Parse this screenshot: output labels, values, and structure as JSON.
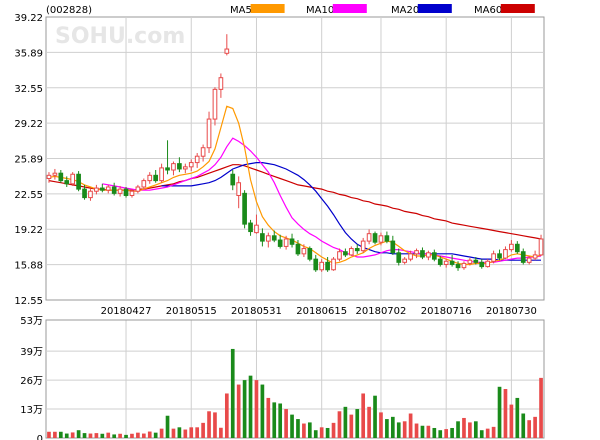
{
  "header": {
    "stock_code": "(002828)",
    "watermark": "SOHU.com"
  },
  "legend": [
    {
      "label": "MA5",
      "color": "#ff9900"
    },
    {
      "label": "MA10",
      "color": "#ff00ff"
    },
    {
      "label": "MA20",
      "color": "#0000cc"
    },
    {
      "label": "MA60",
      "color": "#cc0000"
    }
  ],
  "colors": {
    "up": "#e84a4a",
    "down": "#1a8a1a",
    "grid": "#cfcfcf",
    "frame": "#999999",
    "ma5": "#ff9900",
    "ma10": "#ff00ff",
    "ma20": "#0000cc",
    "ma60": "#cc0000"
  },
  "chart_data": [
    {
      "type": "candlestick",
      "y_ticks": [
        "39.22",
        "35.89",
        "32.55",
        "29.22",
        "25.89",
        "22.55",
        "19.22",
        "15.88",
        "12.55"
      ],
      "ylim": [
        12.55,
        39.22
      ],
      "x_tick_labels": [
        {
          "label": "20180427",
          "index": 13
        },
        {
          "label": "20180515",
          "index": 24
        },
        {
          "label": "20180531",
          "index": 35
        },
        {
          "label": "20180615",
          "index": 46
        },
        {
          "label": "20180702",
          "index": 56
        },
        {
          "label": "20180716",
          "index": 67
        },
        {
          "label": "20180730",
          "index": 78
        }
      ],
      "candles": [
        {
          "o": 24.0,
          "h": 24.6,
          "l": 23.6,
          "c": 24.3
        },
        {
          "o": 24.3,
          "h": 24.9,
          "l": 23.9,
          "c": 24.5
        },
        {
          "o": 24.5,
          "h": 24.8,
          "l": 23.6,
          "c": 23.8
        },
        {
          "o": 23.8,
          "h": 24.2,
          "l": 23.2,
          "c": 23.5
        },
        {
          "o": 23.5,
          "h": 24.6,
          "l": 23.3,
          "c": 24.4
        },
        {
          "o": 24.4,
          "h": 24.7,
          "l": 22.8,
          "c": 23.0
        },
        {
          "o": 23.0,
          "h": 23.4,
          "l": 22.0,
          "c": 22.2
        },
        {
          "o": 22.2,
          "h": 23.0,
          "l": 21.9,
          "c": 22.8
        },
        {
          "o": 22.8,
          "h": 23.4,
          "l": 22.5,
          "c": 23.1
        },
        {
          "o": 23.1,
          "h": 23.5,
          "l": 22.7,
          "c": 22.9
        },
        {
          "o": 22.9,
          "h": 23.4,
          "l": 22.6,
          "c": 23.2
        },
        {
          "o": 23.2,
          "h": 23.6,
          "l": 22.4,
          "c": 22.6
        },
        {
          "o": 22.6,
          "h": 23.3,
          "l": 22.3,
          "c": 23.0
        },
        {
          "o": 23.0,
          "h": 23.2,
          "l": 22.2,
          "c": 22.4
        },
        {
          "o": 22.4,
          "h": 23.0,
          "l": 22.2,
          "c": 22.8
        },
        {
          "o": 22.8,
          "h": 23.4,
          "l": 22.6,
          "c": 23.2
        },
        {
          "o": 23.2,
          "h": 24.0,
          "l": 23.0,
          "c": 23.8
        },
        {
          "o": 23.8,
          "h": 24.6,
          "l": 23.5,
          "c": 24.3
        },
        {
          "o": 24.3,
          "h": 24.8,
          "l": 23.6,
          "c": 23.8
        },
        {
          "o": 23.8,
          "h": 25.4,
          "l": 23.6,
          "c": 25.0
        },
        {
          "o": 25.0,
          "h": 27.6,
          "l": 24.4,
          "c": 24.8
        },
        {
          "o": 24.8,
          "h": 25.6,
          "l": 24.3,
          "c": 25.4
        },
        {
          "o": 25.4,
          "h": 26.0,
          "l": 24.6,
          "c": 24.9
        },
        {
          "o": 24.9,
          "h": 25.4,
          "l": 24.5,
          "c": 25.1
        },
        {
          "o": 25.1,
          "h": 25.8,
          "l": 24.7,
          "c": 25.5
        },
        {
          "o": 25.5,
          "h": 26.4,
          "l": 25.0,
          "c": 26.1
        },
        {
          "o": 26.1,
          "h": 27.2,
          "l": 25.6,
          "c": 26.9
        },
        {
          "o": 26.9,
          "h": 30.3,
          "l": 26.4,
          "c": 29.6
        },
        {
          "o": 29.6,
          "h": 32.6,
          "l": 29.0,
          "c": 32.4
        },
        {
          "o": 32.4,
          "h": 33.9,
          "l": 31.6,
          "c": 33.5
        },
        {
          "o": 35.8,
          "h": 37.6,
          "l": 35.6,
          "c": 36.2
        },
        {
          "o": 24.4,
          "h": 24.8,
          "l": 22.9,
          "c": 23.4
        },
        {
          "o": 22.4,
          "h": 24.2,
          "l": 21.2,
          "c": 23.6
        },
        {
          "o": 22.6,
          "h": 22.9,
          "l": 19.3,
          "c": 19.7
        },
        {
          "o": 19.8,
          "h": 20.1,
          "l": 18.6,
          "c": 19.0
        },
        {
          "o": 18.9,
          "h": 20.6,
          "l": 18.8,
          "c": 19.6
        },
        {
          "o": 18.8,
          "h": 19.3,
          "l": 17.6,
          "c": 18.1
        },
        {
          "o": 18.1,
          "h": 18.9,
          "l": 17.5,
          "c": 18.6
        },
        {
          "o": 18.6,
          "h": 19.1,
          "l": 18.0,
          "c": 18.2
        },
        {
          "o": 18.2,
          "h": 18.7,
          "l": 17.4,
          "c": 17.6
        },
        {
          "o": 17.6,
          "h": 18.6,
          "l": 17.3,
          "c": 18.3
        },
        {
          "o": 18.3,
          "h": 18.8,
          "l": 17.5,
          "c": 17.8
        },
        {
          "o": 17.8,
          "h": 18.2,
          "l": 16.7,
          "c": 16.9
        },
        {
          "o": 16.9,
          "h": 17.8,
          "l": 16.6,
          "c": 17.4
        },
        {
          "o": 17.4,
          "h": 17.6,
          "l": 16.2,
          "c": 16.4
        },
        {
          "o": 16.4,
          "h": 16.8,
          "l": 15.2,
          "c": 15.4
        },
        {
          "o": 15.4,
          "h": 16.4,
          "l": 15.2,
          "c": 16.1
        },
        {
          "o": 16.1,
          "h": 16.6,
          "l": 15.2,
          "c": 15.4
        },
        {
          "o": 15.4,
          "h": 16.6,
          "l": 15.3,
          "c": 16.4
        },
        {
          "o": 16.4,
          "h": 17.4,
          "l": 16.2,
          "c": 17.1
        },
        {
          "o": 17.1,
          "h": 17.4,
          "l": 16.6,
          "c": 16.8
        },
        {
          "o": 16.8,
          "h": 17.6,
          "l": 16.7,
          "c": 17.4
        },
        {
          "o": 17.4,
          "h": 17.8,
          "l": 16.9,
          "c": 17.2
        },
        {
          "o": 17.2,
          "h": 18.4,
          "l": 17.0,
          "c": 18.1
        },
        {
          "o": 18.1,
          "h": 19.2,
          "l": 17.8,
          "c": 18.8
        },
        {
          "o": 18.8,
          "h": 19.0,
          "l": 17.8,
          "c": 18.0
        },
        {
          "o": 18.0,
          "h": 18.9,
          "l": 17.7,
          "c": 18.6
        },
        {
          "o": 18.6,
          "h": 19.0,
          "l": 17.9,
          "c": 18.1
        },
        {
          "o": 18.1,
          "h": 18.6,
          "l": 16.8,
          "c": 17.0
        },
        {
          "o": 17.0,
          "h": 17.4,
          "l": 15.8,
          "c": 16.1
        },
        {
          "o": 16.1,
          "h": 16.6,
          "l": 15.9,
          "c": 16.4
        },
        {
          "o": 16.4,
          "h": 17.2,
          "l": 16.2,
          "c": 16.9
        },
        {
          "o": 16.9,
          "h": 17.4,
          "l": 16.5,
          "c": 17.2
        },
        {
          "o": 17.2,
          "h": 17.5,
          "l": 16.4,
          "c": 16.6
        },
        {
          "o": 16.6,
          "h": 17.2,
          "l": 16.3,
          "c": 17.0
        },
        {
          "o": 17.0,
          "h": 17.3,
          "l": 16.2,
          "c": 16.4
        },
        {
          "o": 16.4,
          "h": 16.7,
          "l": 15.7,
          "c": 15.9
        },
        {
          "o": 15.9,
          "h": 16.4,
          "l": 15.6,
          "c": 16.2
        },
        {
          "o": 16.2,
          "h": 16.8,
          "l": 15.7,
          "c": 15.9
        },
        {
          "o": 15.9,
          "h": 16.2,
          "l": 15.3,
          "c": 15.6
        },
        {
          "o": 15.6,
          "h": 16.2,
          "l": 15.4,
          "c": 16.0
        },
        {
          "o": 16.0,
          "h": 16.5,
          "l": 15.8,
          "c": 16.3
        },
        {
          "o": 16.3,
          "h": 16.6,
          "l": 15.9,
          "c": 16.1
        },
        {
          "o": 16.1,
          "h": 16.4,
          "l": 15.5,
          "c": 15.7
        },
        {
          "o": 15.7,
          "h": 16.4,
          "l": 15.6,
          "c": 16.2
        },
        {
          "o": 16.2,
          "h": 17.2,
          "l": 16.0,
          "c": 16.9
        },
        {
          "o": 16.9,
          "h": 17.3,
          "l": 16.3,
          "c": 16.5
        },
        {
          "o": 16.5,
          "h": 17.6,
          "l": 16.4,
          "c": 17.3
        },
        {
          "o": 17.3,
          "h": 18.2,
          "l": 17.1,
          "c": 17.8
        },
        {
          "o": 17.8,
          "h": 18.1,
          "l": 16.9,
          "c": 17.1
        },
        {
          "o": 17.1,
          "h": 17.4,
          "l": 15.9,
          "c": 16.1
        },
        {
          "o": 16.1,
          "h": 16.7,
          "l": 15.9,
          "c": 16.5
        },
        {
          "o": 16.5,
          "h": 17.2,
          "l": 16.3,
          "c": 16.8
        },
        {
          "o": 16.8,
          "h": 18.7,
          "l": 16.7,
          "c": 18.3
        }
      ],
      "ma5": [
        24.1,
        24.2,
        24.1,
        24.0,
        23.9,
        23.7,
        23.4,
        23.2,
        23.0,
        22.9,
        22.9,
        22.9,
        22.9,
        22.9,
        22.8,
        22.8,
        23.0,
        23.2,
        23.4,
        23.6,
        23.8,
        24.1,
        24.3,
        24.4,
        24.5,
        24.7,
        25.1,
        25.6,
        26.8,
        28.8,
        30.8,
        30.6,
        29.2,
        26.9,
        23.9,
        21.8,
        20.4,
        19.6,
        19.0,
        18.6,
        18.4,
        18.2,
        17.9,
        17.6,
        17.4,
        17.0,
        16.6,
        16.3,
        16.0,
        16.1,
        16.3,
        16.6,
        16.8,
        17.0,
        17.4,
        17.7,
        17.9,
        18.1,
        18.0,
        17.6,
        17.2,
        16.9,
        16.7,
        16.7,
        16.8,
        16.8,
        16.6,
        16.4,
        16.2,
        16.0,
        15.9,
        15.9,
        16.0,
        16.0,
        16.0,
        16.2,
        16.3,
        16.5,
        16.8,
        16.9,
        16.8,
        16.7,
        16.6,
        16.8
      ],
      "ma10": [
        null,
        null,
        null,
        null,
        null,
        null,
        null,
        null,
        null,
        23.5,
        23.4,
        23.3,
        23.2,
        23.1,
        23.0,
        22.9,
        22.9,
        22.9,
        23.0,
        23.1,
        23.2,
        23.4,
        23.6,
        23.8,
        24.0,
        24.2,
        24.5,
        24.8,
        25.3,
        26.0,
        27.0,
        27.8,
        27.5,
        27.1,
        26.6,
        26.0,
        25.3,
        24.6,
        23.6,
        22.4,
        21.3,
        20.3,
        19.7,
        19.2,
        18.8,
        18.5,
        18.1,
        17.8,
        17.5,
        17.3,
        17.0,
        16.8,
        16.6,
        16.6,
        16.7,
        16.8,
        17.0,
        17.2,
        17.3,
        17.3,
        17.2,
        17.1,
        17.0,
        16.9,
        16.9,
        16.8,
        16.7,
        16.6,
        16.5,
        16.4,
        16.3,
        16.2,
        16.1,
        16.1,
        16.1,
        16.1,
        16.2,
        16.3,
        16.4,
        16.5,
        16.5,
        16.6,
        16.6,
        16.7
      ],
      "ma20": [
        null,
        null,
        null,
        null,
        null,
        null,
        null,
        null,
        null,
        null,
        null,
        null,
        null,
        null,
        null,
        null,
        null,
        null,
        null,
        23.3,
        23.3,
        23.3,
        23.3,
        23.3,
        23.3,
        23.4,
        23.5,
        23.6,
        23.8,
        24.1,
        24.5,
        24.9,
        25.1,
        25.3,
        25.4,
        25.5,
        25.5,
        25.4,
        25.3,
        25.1,
        24.9,
        24.6,
        24.3,
        23.9,
        23.4,
        22.8,
        22.1,
        21.4,
        20.6,
        19.7,
        18.9,
        18.3,
        17.8,
        17.5,
        17.3,
        17.1,
        17.0,
        17.0,
        16.9,
        16.9,
        16.9,
        16.9,
        16.9,
        16.9,
        16.9,
        16.9,
        16.9,
        16.9,
        16.9,
        16.8,
        16.7,
        16.6,
        16.5,
        16.4,
        16.4,
        16.4,
        16.3,
        16.3,
        16.3,
        16.3,
        16.3,
        16.3,
        16.3,
        16.3
      ],
      "ma60": [
        23.8,
        23.7,
        23.6,
        23.5,
        23.4,
        23.3,
        23.2,
        23.1,
        23.0,
        23.0,
        22.9,
        22.9,
        22.9,
        22.9,
        22.9,
        23.0,
        23.0,
        23.1,
        23.2,
        23.3,
        23.4,
        23.5,
        23.7,
        23.8,
        24.0,
        24.1,
        24.3,
        24.5,
        24.7,
        24.9,
        25.1,
        25.3,
        25.3,
        25.2,
        25.0,
        24.8,
        24.6,
        24.4,
        24.2,
        24.0,
        23.8,
        23.6,
        23.4,
        23.3,
        23.2,
        23.1,
        23.0,
        22.8,
        22.7,
        22.5,
        22.4,
        22.2,
        22.1,
        21.9,
        21.8,
        21.6,
        21.5,
        21.4,
        21.2,
        21.1,
        20.9,
        20.8,
        20.7,
        20.5,
        20.4,
        20.2,
        20.1,
        20.0,
        19.8,
        19.7,
        19.6,
        19.5,
        19.4,
        19.3,
        19.2,
        19.1,
        19.0,
        18.9,
        18.8,
        18.7,
        18.6,
        18.5,
        18.4,
        18.3
      ]
    },
    {
      "type": "bar",
      "y_ticks": [
        "53万",
        "39万",
        "26万",
        "13万",
        "0"
      ],
      "ylim": [
        0,
        53
      ],
      "unit": "万",
      "volumes": [
        2.8,
        2.8,
        2.8,
        2.0,
        2.5,
        3.5,
        2.2,
        2.0,
        2.2,
        1.9,
        2.4,
        1.6,
        1.9,
        1.4,
        1.9,
        2.4,
        2.0,
        2.9,
        2.4,
        4.2,
        10.0,
        4.2,
        4.8,
        3.8,
        4.8,
        4.8,
        6.8,
        12.0,
        11.5,
        4.6,
        20.0,
        40.0,
        24.0,
        26.0,
        28.0,
        26.0,
        24.0,
        18.0,
        16.0,
        15.5,
        13.0,
        10.5,
        8.5,
        6.5,
        7.0,
        3.5,
        4.8,
        4.5,
        6.8,
        12.0,
        14.0,
        10.5,
        13.0,
        20.0,
        14.0,
        19.0,
        11.5,
        8.5,
        9.5,
        7.0,
        7.5,
        11.0,
        6.5,
        5.5,
        5.5,
        4.5,
        3.5,
        4.0,
        4.5,
        7.5,
        9.0,
        7.0,
        7.5,
        3.5,
        4.2,
        5.0,
        23.0,
        22.0,
        15.0,
        18.0,
        11.0,
        8.0,
        9.5,
        27.0
      ]
    }
  ]
}
